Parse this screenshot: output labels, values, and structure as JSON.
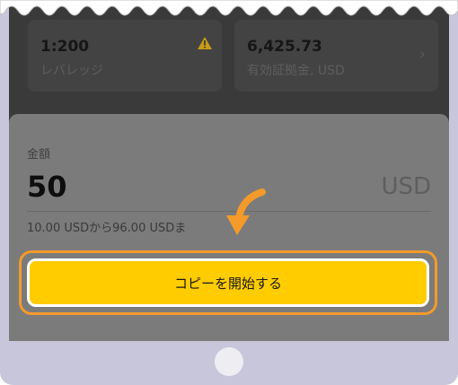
{
  "cards": {
    "leverage": {
      "value": "1:200",
      "label": "レバレッジ"
    },
    "margin": {
      "value": "6,425.73",
      "label": "有効証拠金, USD"
    }
  },
  "amount": {
    "label": "金額",
    "value": "50",
    "currency": "USD",
    "range": "10.00 USDから96.00 USDま"
  },
  "start_button": {
    "label": "コピーを開始する"
  },
  "colors": {
    "accent": "#ffcc00",
    "highlight": "#f39a2b"
  }
}
